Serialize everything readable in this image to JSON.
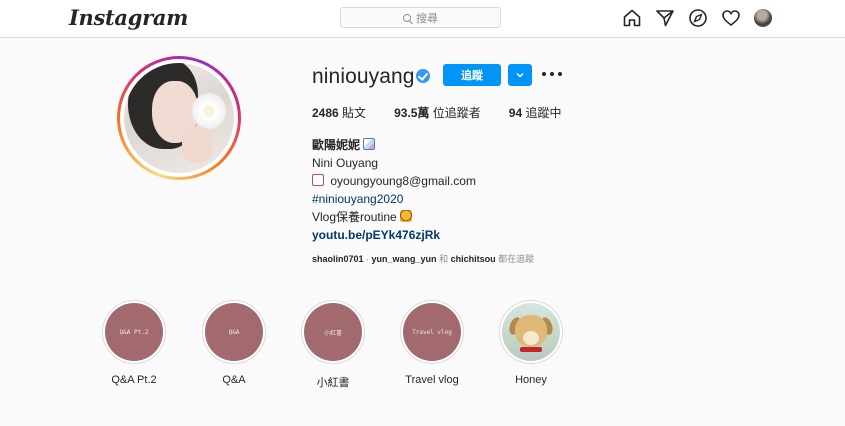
{
  "nav": {
    "logo": "Instagram",
    "search_placeholder": "搜尋",
    "icons": [
      "home-icon",
      "direct-message-icon",
      "explore-icon",
      "activity-heart-icon",
      "profile-avatar"
    ]
  },
  "profile": {
    "username": "niniouyang",
    "verified": true,
    "follow_label": "追蹤",
    "stats": {
      "posts_count": "2486",
      "posts_label": "貼文",
      "followers_count": "93.5萬",
      "followers_label": "位追蹤者",
      "following_count": "94",
      "following_label": "追蹤中"
    },
    "bio": {
      "display_name": "歐陽妮妮",
      "name_line": "Nini Ouyang",
      "email": "oyoungyoung8@gmail.com",
      "hashtag": "#niniouyang2020",
      "vlog_line": "Vlog保養routine",
      "link": "youtu.be/pEYk476zjRk"
    },
    "mutual": {
      "user1": "shaolin0701",
      "separator": " · ",
      "user2": "yun_wang_yun",
      "and": "和",
      "user3": "chichitsou",
      "suffix": "都在追蹤"
    }
  },
  "highlights": [
    {
      "label": "Q&A Pt.2",
      "cover_text": "Q&A Pt.2"
    },
    {
      "label": "Q&A",
      "cover_text": "Q&A"
    },
    {
      "label": "小紅書",
      "cover_text": "小紅書"
    },
    {
      "label": "Travel vlog",
      "cover_text": "Travel vlog"
    },
    {
      "label": "Honey",
      "cover_text": ""
    }
  ],
  "colors": {
    "accent_blue": "#0095f6",
    "verified_blue": "#3897f0",
    "highlight_cover": "#a26a6e",
    "link_text": "#00376b"
  }
}
